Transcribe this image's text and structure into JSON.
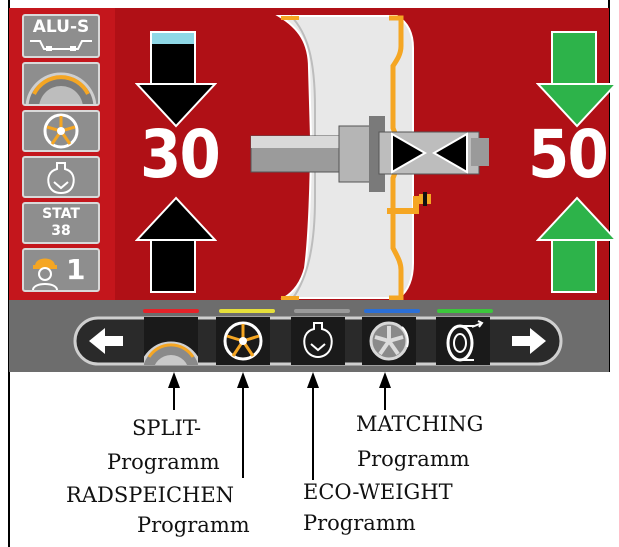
{
  "sidebar": {
    "mode_label": "ALU-S",
    "stat_label": "STAT",
    "stat_value": "38",
    "operator_number": "1"
  },
  "display": {
    "left_value": "30",
    "right_value": "50"
  },
  "colors": {
    "screen_bg": "#b01016",
    "arrow_black": "#000000",
    "arrow_green": "#2db34a",
    "rim_orange": "#f5a623",
    "indicator_cyan": "#8fd8e6"
  },
  "toolbar": {
    "indicators": [
      "#e52229",
      "#e6e03a",
      "#9a9a9a",
      "#2b6fd6",
      "#3cc63c"
    ],
    "icons": [
      "arrow-left-icon",
      "split-wheel-icon",
      "spoke-wheel-icon",
      "weight-icon",
      "matching-wheel-icon",
      "tire-icon",
      "arrow-right-icon"
    ]
  },
  "annotations": {
    "split": [
      "SPLIT-",
      "Programm"
    ],
    "radspeichen": [
      "RADSPEICHEN",
      "Programm"
    ],
    "eco": [
      "ECO-WEIGHT",
      "Programm"
    ],
    "matching": [
      "MATCHING",
      "Programm"
    ]
  }
}
